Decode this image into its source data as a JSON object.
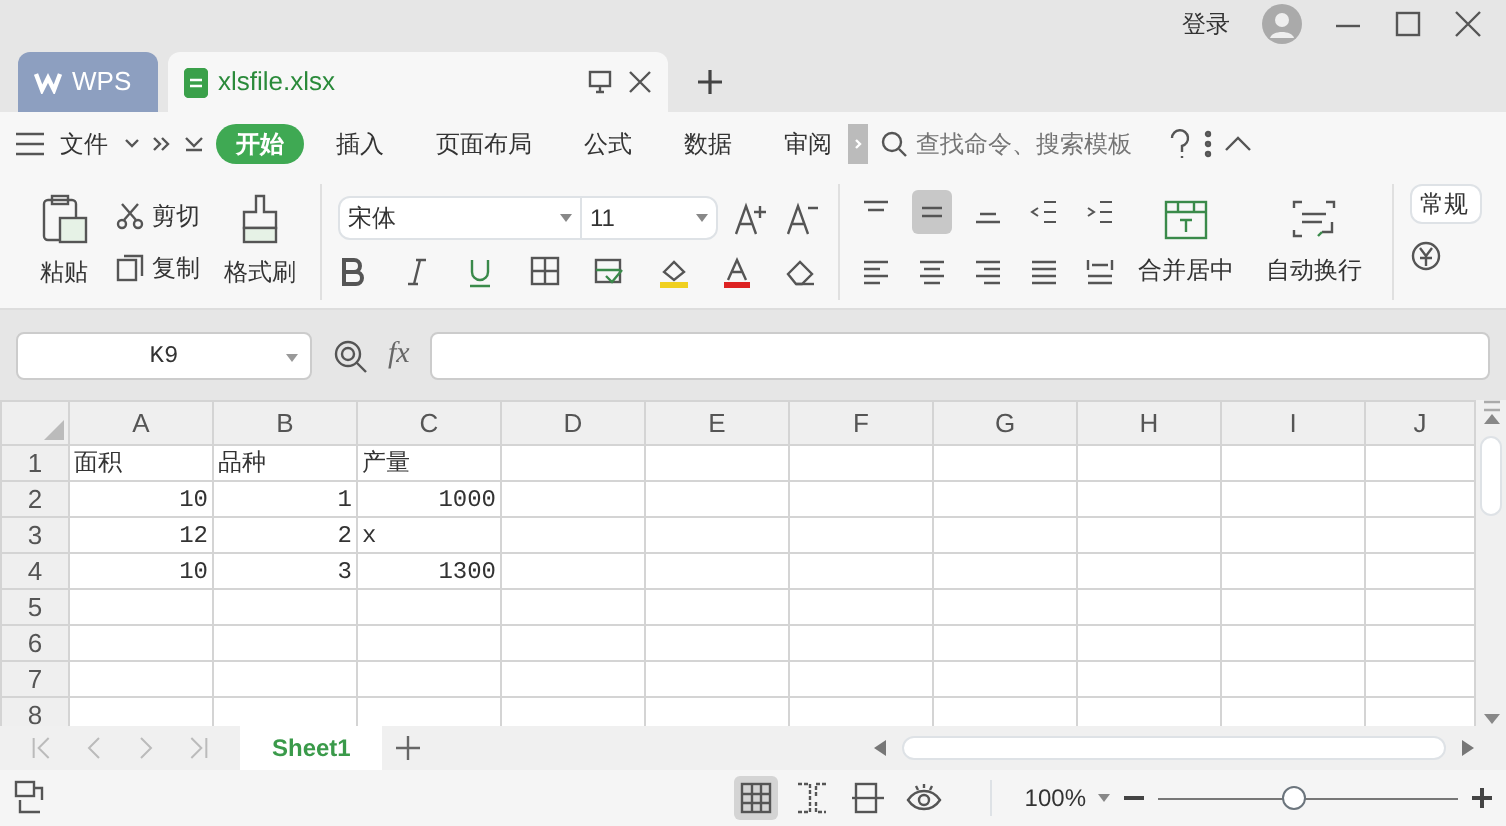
{
  "app_tabs": [
    {
      "label": "WPS",
      "kind": "home",
      "selected": false
    },
    {
      "label": "xlsfile.xlsx",
      "kind": "file",
      "selected": true
    }
  ],
  "login": "登录",
  "menu": {
    "file": "文件",
    "tabs": [
      {
        "label": "开始",
        "selected": true
      },
      {
        "label": "插入",
        "selected": false
      },
      {
        "label": "页面布局",
        "selected": false
      },
      {
        "label": "公式",
        "selected": false
      },
      {
        "label": "数据",
        "selected": false
      },
      {
        "label": "审阅",
        "selected": false
      }
    ],
    "search_placeholder": "查找命令、搜索模板"
  },
  "ribbon": {
    "paste": "粘贴",
    "cut": "剪切",
    "copy": "复制",
    "format_painter": "格式刷",
    "font_name": "宋体",
    "font_size": "11",
    "alignment_buttons": [
      {
        "selected": false
      },
      {
        "selected": true
      },
      {
        "selected": false
      },
      {
        "selected": false
      },
      {
        "selected": false
      },
      {
        "selected": false
      },
      {
        "selected": false
      },
      {
        "selected": false
      },
      {
        "selected": false
      },
      {
        "selected": false
      }
    ],
    "merge": "合并居中",
    "wrap": "自动换行",
    "number_format": "常规"
  },
  "name_box": "K9",
  "fx": "fx",
  "grid": {
    "columns": [
      "A",
      "B",
      "C",
      "D",
      "E",
      "F",
      "G",
      "H",
      "I",
      "J"
    ],
    "rows": [
      {
        "header": "1",
        "cells": [
          {
            "value": "面积",
            "kind": "text"
          },
          {
            "value": "品种",
            "kind": "text"
          },
          {
            "value": "产量",
            "kind": "text"
          }
        ]
      },
      {
        "header": "2",
        "cells": [
          {
            "value": "10",
            "kind": "number"
          },
          {
            "value": "1",
            "kind": "number"
          },
          {
            "value": "1000",
            "kind": "number"
          }
        ]
      },
      {
        "header": "3",
        "cells": [
          {
            "value": "12",
            "kind": "number"
          },
          {
            "value": "2",
            "kind": "number"
          },
          {
            "value": "x",
            "kind": "text"
          }
        ]
      },
      {
        "header": "4",
        "cells": [
          {
            "value": "10",
            "kind": "number"
          },
          {
            "value": "3",
            "kind": "number"
          },
          {
            "value": "1300",
            "kind": "number"
          }
        ]
      },
      {
        "header": "5"
      },
      {
        "header": "6"
      },
      {
        "header": "7"
      },
      {
        "header": "8"
      }
    ]
  },
  "sheets": [
    {
      "label": "Sheet1",
      "selected": true
    }
  ],
  "view_modes": [
    {
      "selected": true
    },
    {
      "selected": false
    },
    {
      "selected": false
    },
    {
      "selected": false
    }
  ],
  "zoom": {
    "label": "100%",
    "level": 0.45
  }
}
